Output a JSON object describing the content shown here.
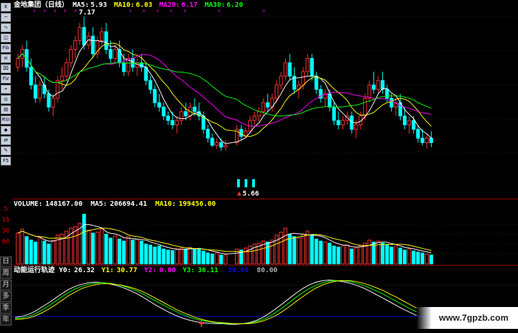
{
  "price_panel": {
    "title": "金地集团（日线）",
    "ma5_label": "MA5:",
    "ma5_value": "5.93",
    "ma10_label": "MA10:",
    "ma10_value": "6.03",
    "ma20_label": "MA20:",
    "ma20_value": "6.17",
    "ma30_label": "MA30:",
    "ma30_value": "6.20",
    "high_label": "7.17",
    "low_label": "5.66",
    "colors": {
      "ma5": "#ffffff",
      "ma10": "#ffff00",
      "ma20": "#ff00ff",
      "ma30": "#00ff00",
      "up": "#ff3333",
      "down": "#00ffff"
    }
  },
  "volume_panel": {
    "label": "VOLUME:",
    "value": "148167.00",
    "ma5_label": "MA5:",
    "ma5_value": "206694.41",
    "ma10_label": "MA10:",
    "ma10_value": "199456.00"
  },
  "indicator_panel": {
    "title": "动能运行轨迹",
    "y0_label": "Y0:",
    "y0_value": "26.32",
    "y1_label": "Y1:",
    "y1_value": "30.77",
    "y2_label": "Y2:",
    "y2_value": "0.00",
    "y3_label": "Y3:",
    "y3_value": "36.11",
    "level_1": "20.00",
    "level_2": "80.00"
  },
  "toolbar": {
    "buttons": [
      "K",
      "~",
      "∿",
      "◫",
      "Fib",
      "≡",
      "⌧",
      "Fiz",
      "⌖",
      "◎",
      "▤",
      "RSI",
      "◆",
      "⇄",
      "✎",
      "F5"
    ],
    "scale_labels": [
      "5",
      "15",
      "30",
      "60"
    ],
    "period_labels": [
      "日",
      "周",
      "月",
      "多",
      "季",
      "年"
    ]
  },
  "watermark": "www.7gpzb.com",
  "chart_data": [
    {
      "type": "candlestick",
      "title": "金地集团（日线）",
      "series": [
        {
          "name": "MA5",
          "color": "#ffffff"
        },
        {
          "name": "MA10",
          "color": "#ffff00"
        },
        {
          "name": "MA20",
          "color": "#ff00ff"
        },
        {
          "name": "MA30",
          "color": "#00ff00"
        }
      ],
      "ohlc": [
        [
          6.6,
          6.75,
          6.55,
          6.7
        ],
        [
          6.7,
          6.85,
          6.6,
          6.8
        ],
        [
          6.8,
          6.9,
          6.55,
          6.6
        ],
        [
          6.6,
          6.7,
          6.35,
          6.4
        ],
        [
          6.4,
          6.5,
          6.2,
          6.25
        ],
        [
          6.25,
          6.45,
          6.2,
          6.4
        ],
        [
          6.4,
          6.5,
          6.25,
          6.3
        ],
        [
          6.3,
          6.35,
          6.1,
          6.15
        ],
        [
          6.15,
          6.3,
          6.05,
          6.25
        ],
        [
          6.25,
          6.5,
          6.2,
          6.45
        ],
        [
          6.45,
          6.6,
          6.35,
          6.5
        ],
        [
          6.5,
          6.7,
          6.45,
          6.65
        ],
        [
          6.65,
          6.85,
          6.6,
          6.8
        ],
        [
          6.8,
          6.95,
          6.7,
          6.9
        ],
        [
          6.9,
          7.1,
          6.85,
          7.05
        ],
        [
          7.05,
          7.17,
          6.8,
          6.85
        ],
        [
          6.85,
          7.0,
          6.8,
          6.95
        ],
        [
          6.95,
          7.05,
          6.7,
          6.75
        ],
        [
          6.75,
          6.95,
          6.7,
          6.9
        ],
        [
          6.9,
          7.05,
          6.85,
          7.0
        ],
        [
          7.0,
          7.1,
          6.75,
          6.8
        ],
        [
          6.8,
          6.9,
          6.65,
          6.7
        ],
        [
          6.7,
          6.85,
          6.65,
          6.8
        ],
        [
          6.8,
          6.9,
          6.6,
          6.65
        ],
        [
          6.65,
          6.75,
          6.5,
          6.55
        ],
        [
          6.55,
          6.75,
          6.5,
          6.7
        ],
        [
          6.7,
          6.8,
          6.55,
          6.6
        ],
        [
          6.6,
          6.7,
          6.5,
          6.65
        ],
        [
          6.65,
          6.75,
          6.55,
          6.6
        ],
        [
          6.6,
          6.65,
          6.4,
          6.45
        ],
        [
          6.45,
          6.5,
          6.3,
          6.35
        ],
        [
          6.35,
          6.4,
          6.15,
          6.2
        ],
        [
          6.2,
          6.3,
          6.1,
          6.15
        ],
        [
          6.15,
          6.2,
          6.0,
          6.05
        ],
        [
          6.05,
          6.1,
          5.95,
          6.0
        ],
        [
          6.0,
          6.1,
          5.9,
          5.95
        ],
        [
          5.95,
          6.05,
          5.85,
          6.0
        ],
        [
          6.0,
          6.15,
          5.95,
          6.1
        ],
        [
          6.1,
          6.2,
          6.0,
          6.05
        ],
        [
          6.05,
          6.2,
          6.0,
          6.15
        ],
        [
          6.15,
          6.25,
          6.05,
          6.1
        ],
        [
          6.1,
          6.2,
          6.0,
          6.05
        ],
        [
          6.05,
          6.1,
          5.85,
          5.9
        ],
        [
          5.9,
          5.95,
          5.75,
          5.8
        ],
        [
          5.8,
          5.85,
          5.7,
          5.72
        ],
        [
          5.72,
          5.8,
          5.68,
          5.75
        ],
        [
          5.75,
          5.8,
          5.66,
          5.7
        ],
        [
          5.7,
          5.78,
          5.66,
          5.72
        ]
      ],
      "gap_note": "5.66",
      "ohlc_right": [
        [
          5.75,
          5.95,
          5.72,
          5.9
        ],
        [
          5.9,
          5.95,
          5.78,
          5.82
        ],
        [
          5.82,
          5.92,
          5.8,
          5.88
        ],
        [
          5.88,
          6.05,
          5.85,
          6.0
        ],
        [
          6.0,
          6.1,
          5.95,
          6.05
        ],
        [
          6.05,
          6.15,
          5.98,
          6.1
        ],
        [
          6.1,
          6.25,
          6.05,
          6.2
        ],
        [
          6.2,
          6.3,
          6.1,
          6.15
        ],
        [
          6.15,
          6.3,
          6.1,
          6.25
        ],
        [
          6.25,
          6.45,
          6.2,
          6.4
        ],
        [
          6.4,
          6.55,
          6.35,
          6.5
        ],
        [
          6.5,
          6.7,
          6.45,
          6.65
        ],
        [
          6.65,
          6.75,
          6.45,
          6.5
        ],
        [
          6.5,
          6.6,
          6.3,
          6.35
        ],
        [
          6.35,
          6.45,
          6.25,
          6.4
        ],
        [
          6.4,
          6.6,
          6.35,
          6.55
        ],
        [
          6.55,
          6.75,
          6.5,
          6.7
        ],
        [
          6.7,
          6.75,
          6.45,
          6.5
        ],
        [
          6.5,
          6.55,
          6.3,
          6.35
        ],
        [
          6.35,
          6.4,
          6.2,
          6.25
        ],
        [
          6.25,
          6.35,
          6.15,
          6.3
        ],
        [
          6.3,
          6.35,
          6.1,
          6.15
        ],
        [
          6.15,
          6.2,
          5.95,
          6.0
        ],
        [
          6.0,
          6.1,
          5.9,
          5.95
        ],
        [
          5.95,
          6.05,
          5.9,
          6.0
        ],
        [
          6.0,
          6.1,
          5.95,
          6.05
        ],
        [
          6.05,
          6.1,
          5.85,
          5.9
        ],
        [
          5.9,
          6.0,
          5.8,
          5.95
        ],
        [
          5.95,
          6.1,
          5.9,
          6.05
        ],
        [
          6.05,
          6.3,
          6.0,
          6.25
        ],
        [
          6.25,
          6.45,
          6.2,
          6.4
        ],
        [
          6.4,
          6.55,
          6.3,
          6.35
        ],
        [
          6.35,
          6.5,
          6.3,
          6.45
        ],
        [
          6.45,
          6.55,
          6.3,
          6.35
        ],
        [
          6.35,
          6.4,
          6.2,
          6.25
        ],
        [
          6.25,
          6.3,
          6.1,
          6.15
        ],
        [
          6.15,
          6.25,
          6.05,
          6.2
        ],
        [
          6.2,
          6.3,
          6.0,
          6.05
        ],
        [
          6.05,
          6.15,
          5.9,
          5.95
        ],
        [
          5.95,
          6.05,
          5.85,
          6.0
        ],
        [
          6.0,
          6.05,
          5.85,
          5.9
        ],
        [
          5.9,
          5.95,
          5.75,
          5.8
        ],
        [
          5.8,
          5.9,
          5.72,
          5.75
        ],
        [
          5.75,
          5.85,
          5.68,
          5.8
        ],
        [
          5.8,
          5.88,
          5.7,
          5.75
        ]
      ],
      "ylim": [
        5.6,
        7.25
      ]
    },
    {
      "type": "bar",
      "title": "VOLUME",
      "values": [
        62,
        70,
        55,
        48,
        44,
        52,
        46,
        40,
        47,
        58,
        60,
        66,
        72,
        75,
        82,
        100,
        68,
        62,
        64,
        70,
        60,
        52,
        56,
        50,
        46,
        55,
        48,
        50,
        46,
        40,
        38,
        34,
        36,
        30,
        28,
        27,
        29,
        32,
        30,
        33,
        31,
        30,
        26,
        22,
        20,
        22,
        18,
        18,
        30,
        28,
        32,
        36,
        40,
        42,
        46,
        44,
        48,
        58,
        64,
        72,
        60,
        55,
        52,
        60,
        66,
        58,
        50,
        46,
        44,
        42,
        36,
        34,
        36,
        38,
        30,
        32,
        36,
        42,
        48,
        44,
        46,
        42,
        38,
        34,
        36,
        32,
        28,
        30,
        26,
        24,
        22,
        20,
        18
      ],
      "ylabel": "",
      "ylim": [
        0,
        110
      ]
    },
    {
      "type": "line",
      "title": "动能运行轨迹",
      "series": [
        {
          "name": "Y0",
          "color": "#ffffff",
          "values": [
            18,
            20,
            24,
            30,
            38,
            46,
            55,
            64,
            72,
            78,
            82,
            85,
            86,
            85,
            83,
            80,
            76,
            71,
            65,
            58,
            50,
            42,
            35,
            28,
            22,
            17,
            13,
            10,
            8,
            7,
            6,
            6,
            5,
            5,
            6,
            8,
            12,
            18,
            26,
            35,
            45,
            55,
            65,
            74,
            81,
            86,
            89,
            90,
            89,
            87,
            84,
            80,
            75,
            69,
            62,
            55,
            48,
            41,
            34,
            28,
            22
          ]
        },
        {
          "name": "Y1",
          "color": "#00ff00",
          "values": [
            16,
            17,
            20,
            25,
            32,
            40,
            49,
            58,
            66,
            73,
            78,
            82,
            84,
            85,
            84,
            82,
            79,
            75,
            70,
            64,
            57,
            50,
            43,
            36,
            30,
            24,
            19,
            15,
            12,
            10,
            8,
            7,
            6,
            6,
            6,
            7,
            10,
            14,
            20,
            28,
            37,
            47,
            57,
            66,
            74,
            80,
            85,
            88,
            89,
            89,
            87,
            84,
            80,
            75,
            69,
            63,
            56,
            49,
            42,
            35,
            29
          ]
        },
        {
          "name": "Y3",
          "color": "#ffff00",
          "values": [
            14,
            15,
            17,
            21,
            27,
            34,
            42,
            51,
            60,
            67,
            74,
            78,
            81,
            83,
            83,
            82,
            80,
            77,
            73,
            68,
            62,
            55,
            48,
            41,
            34,
            28,
            23,
            18,
            14,
            11,
            9,
            8,
            7,
            6,
            6,
            6,
            8,
            11,
            16,
            22,
            30,
            39,
            49,
            58,
            67,
            75,
            81,
            85,
            88,
            89,
            89,
            87,
            84,
            80,
            75,
            70,
            63,
            57,
            50,
            43,
            36
          ]
        }
      ],
      "levels": [
        20,
        80
      ],
      "ylim": [
        0,
        100
      ]
    }
  ]
}
